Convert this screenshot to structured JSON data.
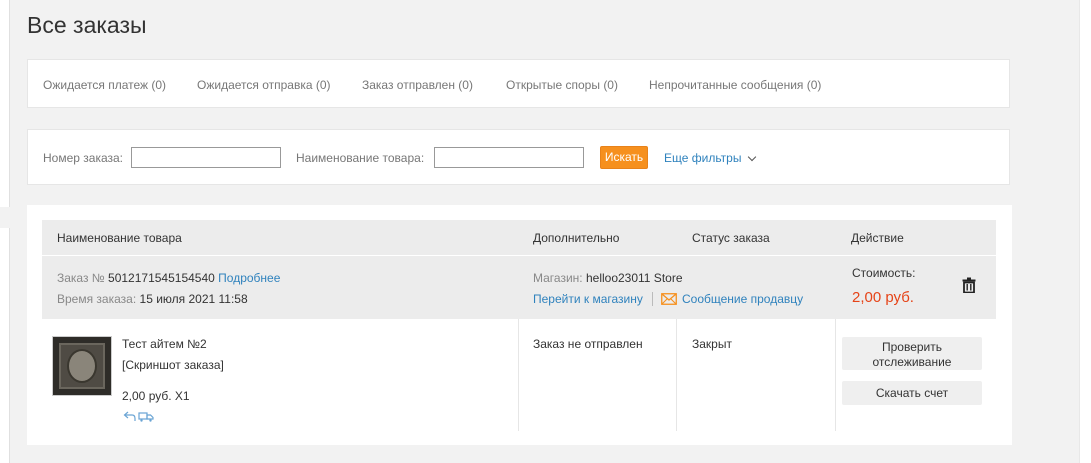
{
  "page_title": "Все заказы",
  "tabs": [
    {
      "label": "Ожидается платеж (0)"
    },
    {
      "label": "Ожидается отправка (0)"
    },
    {
      "label": "Заказ отправлен (0)"
    },
    {
      "label": "Открытые споры (0)"
    },
    {
      "label": "Непрочитанные сообщения (0)"
    }
  ],
  "filters": {
    "order_number_label": "Номер заказа:",
    "order_number_value": "",
    "product_name_label": "Наименование товара:",
    "product_name_value": "",
    "search_button": "Искать",
    "more_filters": "Еще фильтры"
  },
  "table": {
    "headers": {
      "product": "Наименование товара",
      "additional": "Дополнительно",
      "status": "Статус заказа",
      "action": "Действие"
    }
  },
  "order": {
    "number_label": "Заказ №",
    "number": "5012171545154540",
    "details_link": "Подробнее",
    "time_label": "Время заказа:",
    "time": "15 июля 2021 11:58",
    "store_label": "Магазин:",
    "store_name": "helloo23011 Store",
    "go_to_store": "Перейти к магазину",
    "message_seller": "Сообщение продавцу",
    "cost_label": "Стоимость:",
    "cost": "2,00 руб.",
    "item": {
      "title": "Тест айтем №2",
      "screenshot": "[Скриншот заказа]",
      "price_qty": "2,00 руб. X1"
    },
    "shipping_status": "Заказ не отправлен",
    "order_status": "Закрыт",
    "actions": {
      "track": "Проверить отслеживание",
      "invoice": "Скачать счет"
    }
  },
  "colors": {
    "accent": "#f6901e",
    "link": "#2f82bd",
    "price": "#e64418"
  }
}
